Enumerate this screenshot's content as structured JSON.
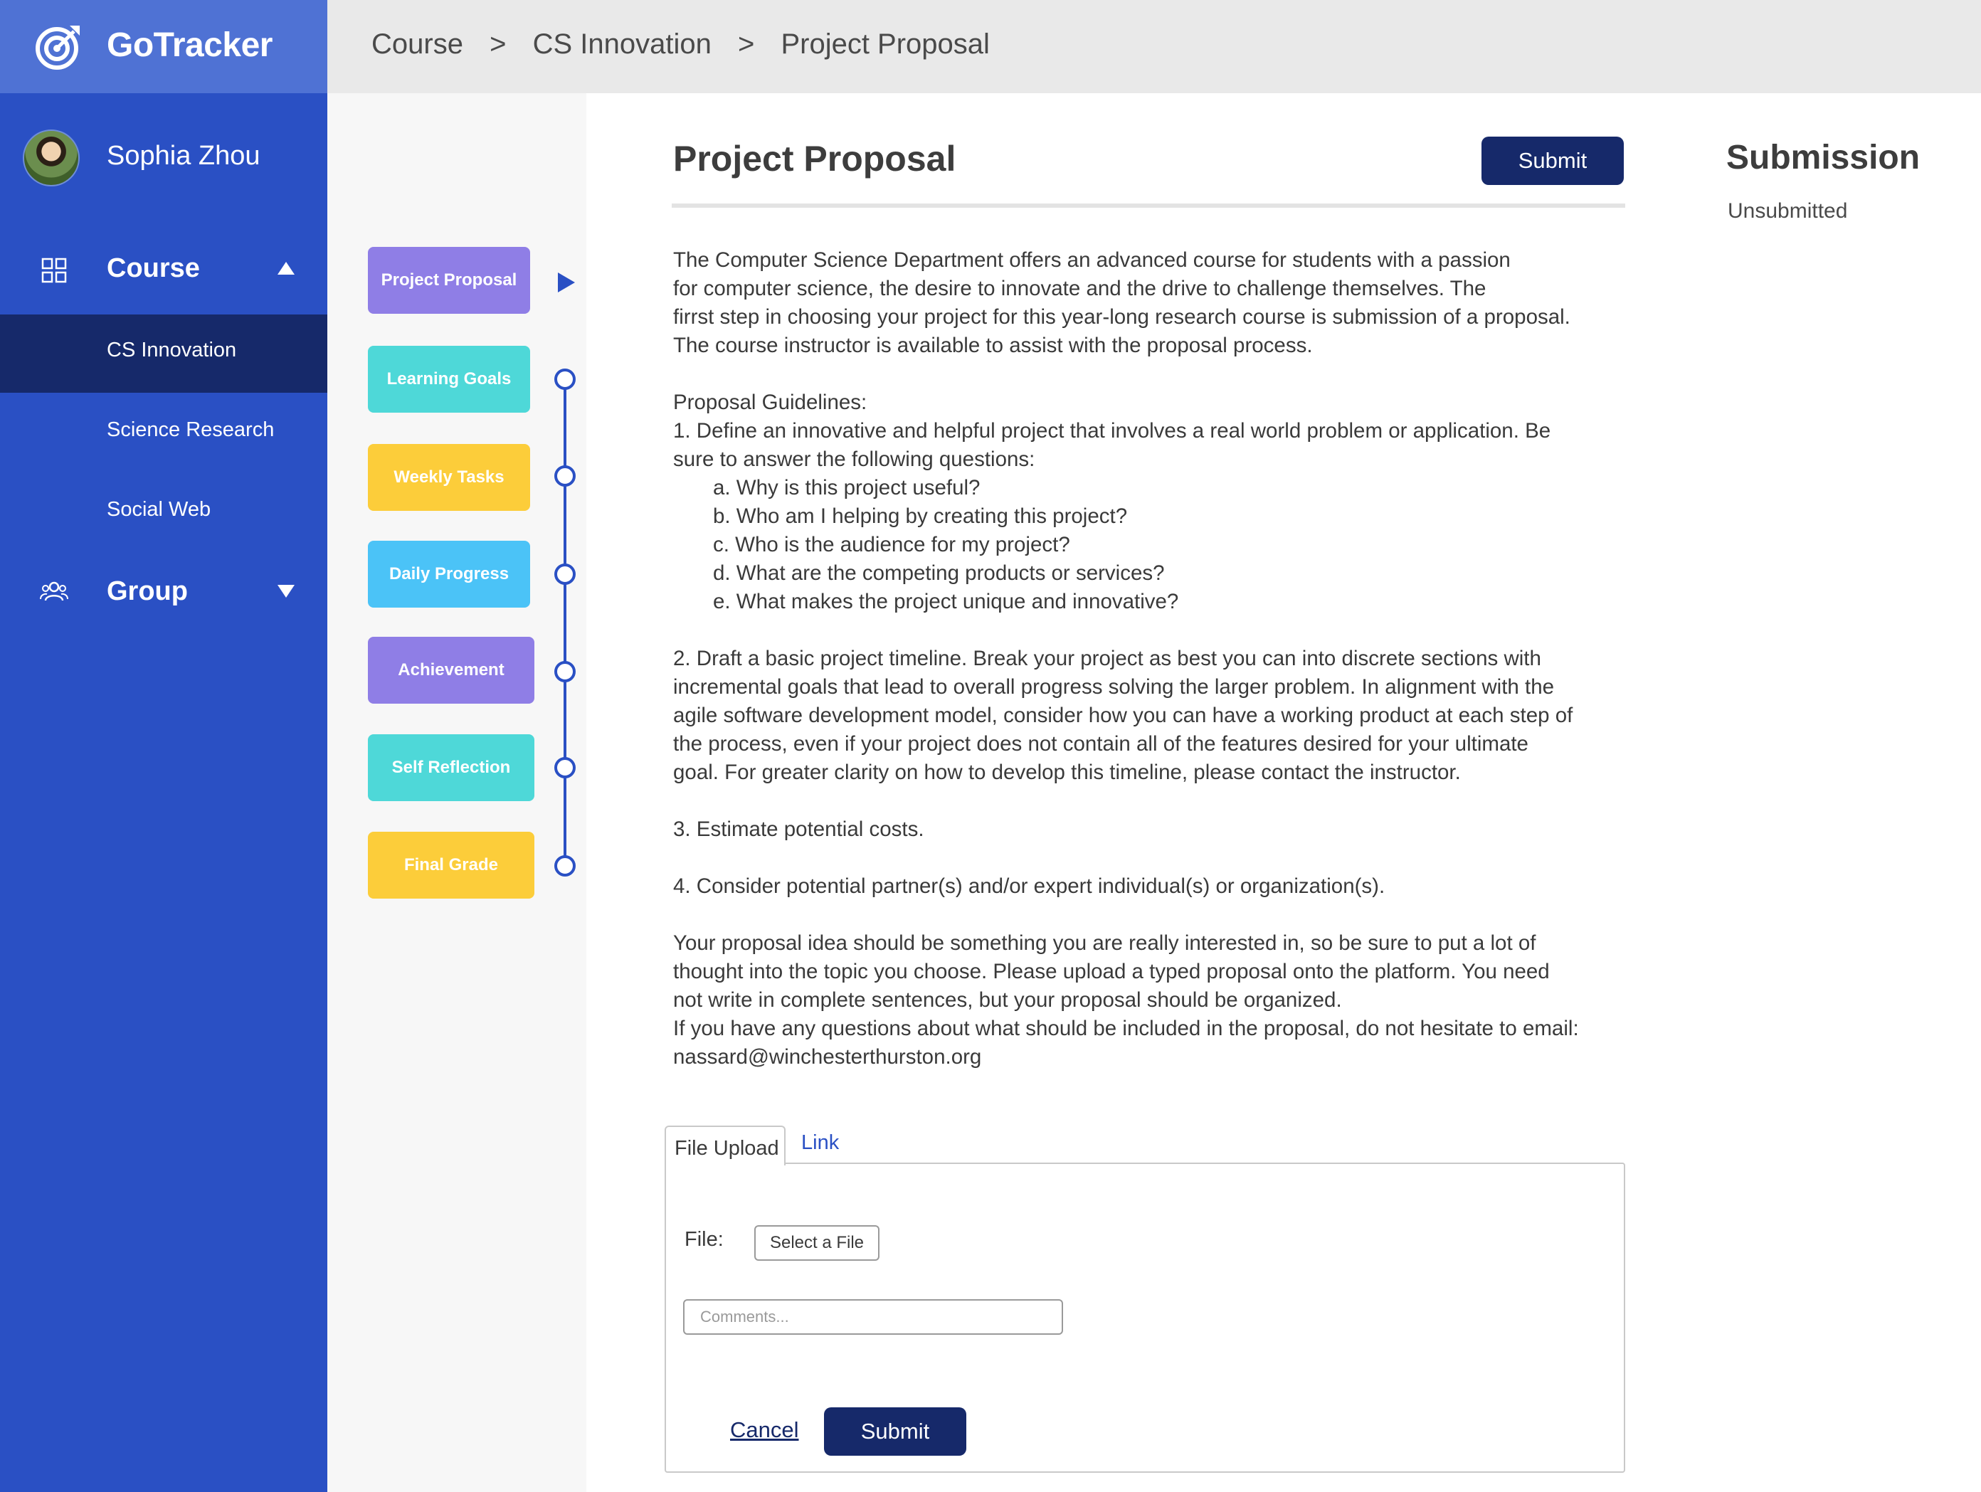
{
  "app": {
    "name": "GoTracker"
  },
  "user": {
    "name": "Sophia Zhou"
  },
  "sidebar": {
    "course": {
      "label": "Course",
      "items": [
        {
          "label": "CS Innovation",
          "active": true
        },
        {
          "label": "Science Research",
          "active": false
        },
        {
          "label": "Social Web",
          "active": false
        }
      ]
    },
    "group": {
      "label": "Group"
    }
  },
  "breadcrumb": [
    "Course",
    ">",
    "CS Innovation",
    ">",
    "Project Proposal"
  ],
  "steps": [
    {
      "label": "Project Proposal",
      "color": "#8f7ee6",
      "current": true
    },
    {
      "label": "Learning Goals",
      "color": "#4ed8d8"
    },
    {
      "label": "Weekly Tasks",
      "color": "#fccd3a"
    },
    {
      "label": "Daily Progress",
      "color": "#4bc3f7"
    },
    {
      "label": "Achievement",
      "color": "#8f7ee6"
    },
    {
      "label": "Self Reflection",
      "color": "#4ed8d8"
    },
    {
      "label": "Final Grade",
      "color": "#fccd3a"
    }
  ],
  "main": {
    "title": "Project Proposal",
    "submit_label": "Submit",
    "intro": "The Computer Science Department offers an advanced course for students with a passion\nfor computer science, the desire to innovate and the drive to challenge themselves. The\nfirrst step in choosing your project for this year-long research course is submission of a proposal.\nThe course instructor is available to assist with the proposal process.",
    "guidelines_heading": "Proposal Guidelines:",
    "guideline_1": "1. Define an innovative and helpful project that involves a real world problem or application. Be\nsure to answer the following questions:",
    "questions": [
      "a. Why is this project useful?",
      "b. Who am I helping by creating this project?",
      "c. Who is the audience for my project?",
      "d. What are the competing products or services?",
      "e. What makes the project unique and innovative?"
    ],
    "guideline_2": "2. Draft a basic project timeline. Break your project as best you can into discrete sections with\nincremental goals that lead to overall progress solving the larger problem. In alignment with the\nagile software development model, consider how you can have a working product at each step of\nthe process, even if your project does not contain all of the features desired for your ultimate\ngoal. For greater clarity on how to develop this timeline, please contact the instructor.",
    "guideline_3": "3. Estimate potential costs.",
    "guideline_4": "4. Consider potential partner(s) and/or expert individual(s) or organization(s).",
    "closing": "Your proposal idea should be something you are really interested in, so be sure to put a lot of\nthought into the topic you choose. Please upload a typed proposal onto the platform. You need\nnot write in complete sentences, but your proposal should be organized.\nIf you have any questions about what should be included in the proposal, do not hesitate to email:\nnassard@winchesterthurston.org"
  },
  "submission": {
    "title": "Submission",
    "status": "Unsubmitted"
  },
  "upload": {
    "tabs": {
      "file": "File Upload",
      "link": "Link"
    },
    "file_label": "File:",
    "select_file_label": "Select a File",
    "comments_placeholder": "Comments...",
    "comments_value": "",
    "cancel_label": "Cancel",
    "submit_label": "Submit"
  },
  "colors": {
    "sidebar": "#2a50c4",
    "brand_bar": "#4f72d4",
    "active_item": "#16296a",
    "primary_button": "#16296a"
  }
}
